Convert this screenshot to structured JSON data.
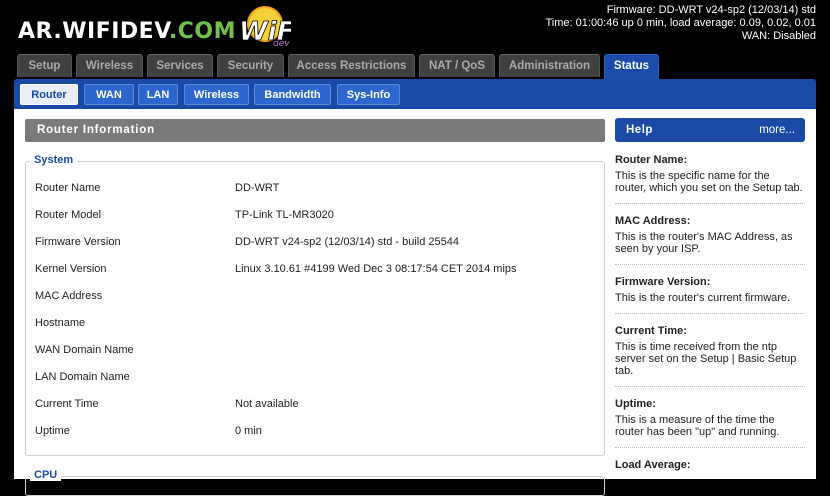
{
  "header": {
    "logo_host": "AR.WIFIDEV",
    "logo_tld": ".COM",
    "logo_badge": "WiFi",
    "logo_badge_sub": "dev",
    "firmware_line": "Firmware: DD-WRT v24-sp2 (12/03/14) std",
    "time_line": "Time: 01:00:46 up 0 min, load average: 0.09, 0.02, 0.01",
    "wan_line": "WAN: Disabled"
  },
  "main_tabs": [
    "Setup",
    "Wireless",
    "Services",
    "Security",
    "Access Restrictions",
    "NAT / QoS",
    "Administration",
    "Status"
  ],
  "sub_tabs": [
    "Router",
    "WAN",
    "LAN",
    "Wireless",
    "Bandwidth",
    "Sys-Info"
  ],
  "section_title": "Router Information",
  "system": {
    "legend": "System",
    "rows": [
      {
        "label": "Router Name",
        "value": "DD-WRT"
      },
      {
        "label": "Router Model",
        "value": "TP-Link TL-MR3020"
      },
      {
        "label": "Firmware Version",
        "value": "DD-WRT v24-sp2 (12/03/14) std - build 25544"
      },
      {
        "label": "Kernel Version",
        "value": "Linux 3.10.61 #4199 Wed Dec 3 08:17:54 CET 2014 mips"
      },
      {
        "label": "MAC Address",
        "value": ""
      },
      {
        "label": "Hostname",
        "value": ""
      },
      {
        "label": "WAN Domain Name",
        "value": ""
      },
      {
        "label": "LAN Domain Name",
        "value": ""
      },
      {
        "label": "Current Time",
        "value": "Not available"
      },
      {
        "label": "Uptime",
        "value": "0 min"
      }
    ]
  },
  "cpu_legend": "CPU",
  "help": {
    "title": "Help",
    "more": "more...",
    "items": [
      {
        "heading": "Router Name:",
        "lines": [
          "This is the specific name for the",
          "router, which you set on the Setup tab."
        ]
      },
      {
        "heading": "MAC Address:",
        "lines": [
          "This is the router's MAC Address, as",
          "seen by your ISP."
        ]
      },
      {
        "heading": "Firmware Version:",
        "lines": [
          "This is the router's current firmware."
        ]
      },
      {
        "heading": "Current Time:",
        "lines": [
          "This is time received from the ntp",
          "server set on the Setup | Basic Setup",
          "tab."
        ]
      },
      {
        "heading": "Uptime:",
        "lines": [
          "This is a measure of the time the",
          "router has been \"up\" and running."
        ]
      },
      {
        "heading": "Load Average:",
        "lines": []
      }
    ]
  },
  "colors": {
    "accent": "#1a4aa6",
    "active_tab": "#1c4caa",
    "section_bar": "#7a7a7a"
  }
}
